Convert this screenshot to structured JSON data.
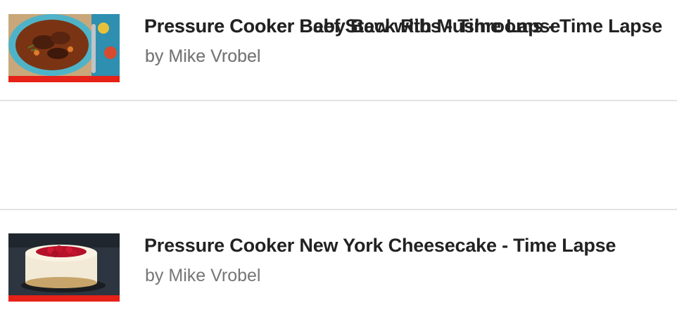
{
  "videos": [
    {
      "title": "Pressure Cooker Baby Back Ribs - Time Lapse",
      "author_prefix": "by",
      "author": "Mike Vrobel",
      "thumbnail_icon": "ribs-thumbnail",
      "watched_fraction": 0
    },
    {
      "title": "Pressure Cooker New York Cheesecake - Time Lapse",
      "author_prefix": "by",
      "author": "Mike Vrobel",
      "thumbnail_icon": "cheesecake-thumbnail",
      "watched_fraction": 1.0
    },
    {
      "title": "Pressure Cooker Beef Stew with Mushrooms - Time Lapse",
      "author_prefix": "by",
      "author": "Mike Vrobel",
      "thumbnail_icon": "beef-stew-thumbnail",
      "watched_fraction": 1.0
    }
  ],
  "colors": {
    "progress": "#e62117",
    "title": "#222222",
    "author": "#767676",
    "divider": "#e3e3e3"
  }
}
